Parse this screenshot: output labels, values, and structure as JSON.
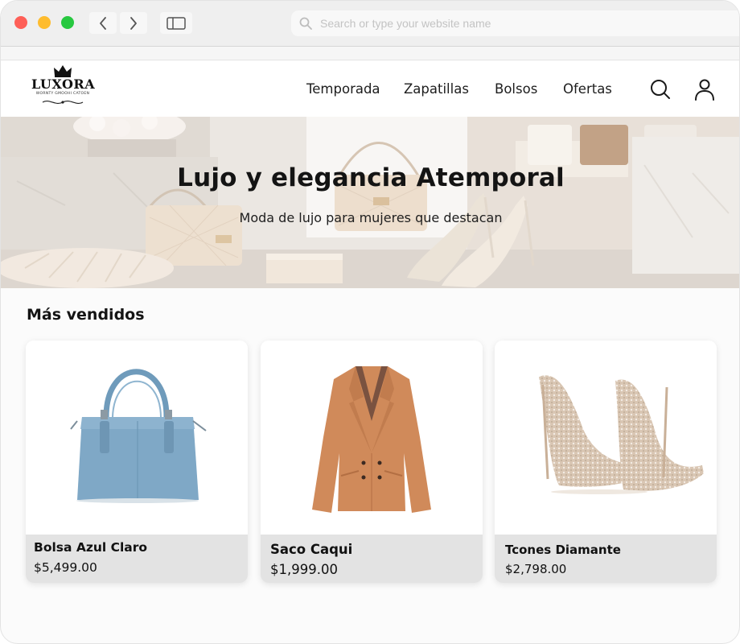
{
  "browser": {
    "address_placeholder": "Search or type your website name",
    "icons": [
      "close-dot",
      "minimize-dot",
      "maximize-dot",
      "chevron-left-icon",
      "chevron-right-icon",
      "sidebar-icon",
      "search-icon"
    ]
  },
  "header": {
    "logo": {
      "name": "LUXORA",
      "tagline": "WORNTY GMOOHI CATOEN"
    },
    "nav": [
      {
        "label": "Temporada"
      },
      {
        "label": "Zapatillas"
      },
      {
        "label": "Bolsos"
      },
      {
        "label": "Ofertas"
      }
    ],
    "icons": [
      "search-icon",
      "user-icon"
    ]
  },
  "hero": {
    "title": "Lujo y elegancia Atemporal",
    "subtitle": "Moda de lujo para mujeres que destacan"
  },
  "best_sellers": {
    "title": "Más vendidos",
    "products": [
      {
        "name": "Bolsa Azul Claro",
        "price": "$5,499.00"
      },
      {
        "name": "Saco Caqui",
        "price": "$1,999.00"
      },
      {
        "name": "Tcones Diamante",
        "price": "$2,798.00"
      }
    ]
  },
  "colors": {
    "accent_dark": "#141414",
    "card_info_bg": "#e3e3e3",
    "bag_blue": "#7fa8c6",
    "jacket_khaki": "#d08a5a"
  }
}
